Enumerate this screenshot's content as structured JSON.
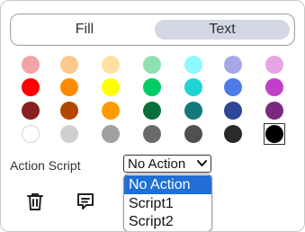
{
  "tabs": {
    "fill_label": "Fill",
    "text_label": "Text",
    "active": "Text"
  },
  "palette": {
    "rows": [
      [
        "#f2a3a3",
        "#fbc98a",
        "#ffe0a0",
        "#8fe0b0",
        "#8ff7ff",
        "#a7a7e8",
        "#e7a4e4"
      ],
      [
        "#ff0000",
        "#ff8a00",
        "#ffff00",
        "#00cc66",
        "#22d3d3",
        "#4f7be8",
        "#c23ec9"
      ],
      [
        "#8a1f1f",
        "#b34700",
        "#ff9a00",
        "#0a6f38",
        "#137878",
        "#2f4595",
        "#7a2880"
      ],
      [
        "#ffffff",
        "#cfcfcf",
        "#a0a0a0",
        "#6a6a6a",
        "#505050",
        "#2a2a2a",
        "#000000"
      ]
    ],
    "selected": "#000000"
  },
  "action": {
    "label": "Action Script",
    "selected_value": "No Action",
    "options": [
      "No Action",
      "Script1",
      "Script2"
    ]
  },
  "icons": {
    "delete": "trash-icon",
    "comment": "comment-icon",
    "chevron": "chevron-down-icon"
  },
  "colors": {
    "active_tab": "#d3d7e3",
    "option_highlight": "#1f6fd6"
  }
}
